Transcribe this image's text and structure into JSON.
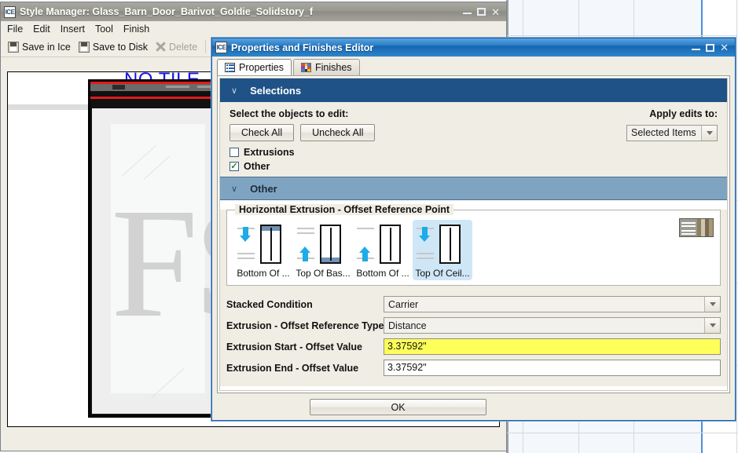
{
  "desktop": {
    "background_color": "#ffffff",
    "grid_fill": "#f4f8fc",
    "grid_line": "#d4d9e0",
    "accent_line": "#4a90d9"
  },
  "style_manager": {
    "app_badge": "ICE",
    "title": "Style Manager: Glass_Barn_Door_Barivot_Goldie_Solidstory_f",
    "menu": [
      "File",
      "Edit",
      "Insert",
      "Tool",
      "Finish"
    ],
    "toolbar": [
      {
        "label": "Save in Ice",
        "icon": "save-icon",
        "enabled": true
      },
      {
        "label": "Save to Disk",
        "icon": "save-icon",
        "enabled": true
      },
      {
        "label": "Delete",
        "icon": "delete-x-icon",
        "enabled": false
      }
    ],
    "canvas": {
      "no_tile_text": "NO TILE",
      "preview_mark": "FS"
    },
    "window_buttons": [
      "minimize",
      "maximize",
      "close"
    ]
  },
  "editor": {
    "app_badge": "ICE",
    "title": "Properties and Finishes Editor",
    "window_buttons": [
      "minimize",
      "maximize",
      "close"
    ],
    "tabs": [
      {
        "label": "Properties",
        "icon": "list-icon",
        "active": true
      },
      {
        "label": "Finishes",
        "icon": "color-swatch-icon",
        "active": false
      }
    ],
    "selections": {
      "header": "Selections",
      "prompt": "Select the objects to edit:",
      "check_all_label": "Check All",
      "uncheck_all_label": "Uncheck All",
      "apply_label": "Apply edits to:",
      "apply_value": "Selected Items",
      "checkboxes": [
        {
          "label": "Extrusions",
          "checked": false
        },
        {
          "label": "Other",
          "checked": true
        }
      ]
    },
    "other": {
      "header": "Other",
      "group_title": "Horizontal Extrusion - Offset Reference Point",
      "options": [
        {
          "label": "Bottom Of ...",
          "selected": false,
          "arrow": "down",
          "band": "top"
        },
        {
          "label": "Top Of Bas...",
          "selected": false,
          "arrow": "up",
          "band": "bottom"
        },
        {
          "label": "Bottom Of ...",
          "selected": false,
          "arrow": "up",
          "band": "none"
        },
        {
          "label": "Top Of Ceil...",
          "selected": true,
          "arrow": "down",
          "band": "none"
        }
      ],
      "fields": [
        {
          "label": "Stacked Condition",
          "value": "Carrier",
          "type": "combo",
          "highlighted": false
        },
        {
          "label": "Extrusion - Offset Reference Type",
          "value": "Distance",
          "type": "combo",
          "highlighted": false
        },
        {
          "label": "Extrusion Start - Offset Value",
          "value": "3.37592\"",
          "type": "text",
          "highlighted": true
        },
        {
          "label": "Extrusion End - Offset Value",
          "value": "3.37592\"",
          "type": "text",
          "highlighted": false
        }
      ]
    },
    "ok_label": "OK"
  },
  "colors": {
    "selections_header": "#1f5286",
    "other_header": "#7fa4c2",
    "highlight_field": "#ffff5a",
    "selected_option": "#cfe6f7",
    "arrow_blue": "#1eabe8",
    "no_tile_text": "#1414e6"
  }
}
